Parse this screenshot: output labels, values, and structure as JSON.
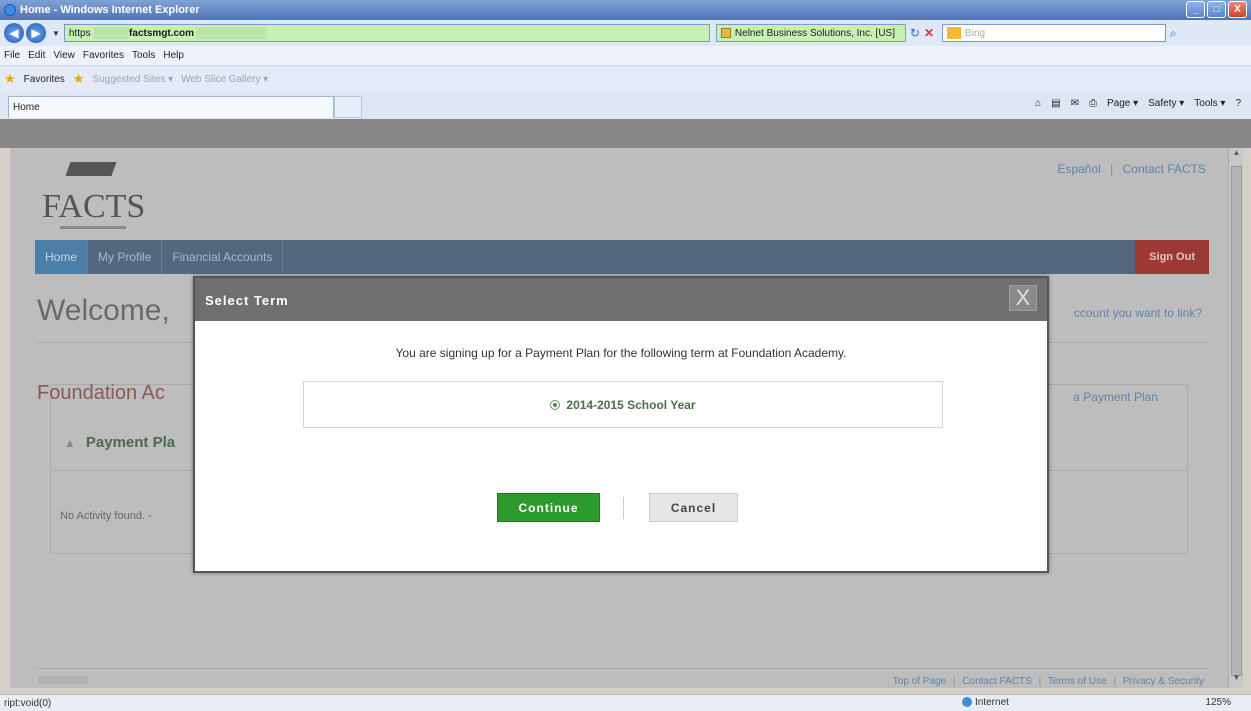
{
  "window": {
    "title": "Home - Windows Internet Explorer",
    "min_label": "_",
    "max_label": "□",
    "close_label": "X"
  },
  "address": {
    "protocol": "https",
    "host": "factsmgt.com",
    "cert": "Nelnet Business Solutions, Inc. [US]",
    "search_placeholder": "Bing"
  },
  "menu": [
    "File",
    "Edit",
    "View",
    "Favorites",
    "Tools",
    "Help"
  ],
  "favorites": {
    "label": "Favorites",
    "suggested": "Suggested Sites ▾",
    "gallery": "Web Slice Gallery ▾"
  },
  "tab": {
    "label": "Home"
  },
  "commandbar": {
    "page": "Page ▾",
    "safety": "Safety ▾",
    "tools": "Tools ▾",
    "help": "?"
  },
  "site": {
    "logo_text": "FACTS",
    "toplinks": {
      "espanol": "Español",
      "contact": "Contact FACTS"
    },
    "nav": {
      "home": "Home",
      "profile": "My Profile",
      "accounts": "Financial Accounts",
      "signout": "Sign Out"
    },
    "welcome": "Welcome,",
    "link_account": "ccount you want to link?",
    "school": "Foundation Ac",
    "payment_plan_link": "a Payment Plan",
    "panel_title": "Payment Pla",
    "no_activity": "No Activity found. -",
    "footer": {
      "top": "Top of Page",
      "contact": "Contact FACTS",
      "terms": "Terms of Use",
      "privacy": "Privacy & Security"
    }
  },
  "modal": {
    "title": "Select Term",
    "close": "X",
    "message": "You are signing up for a Payment Plan for the following term at Foundation Academy.",
    "term": "2014-2015 School Year",
    "continue": "Continue",
    "cancel": "Cancel"
  },
  "status": {
    "left": "ript:void(0)",
    "zone": "Internet",
    "zoom": "125%"
  }
}
